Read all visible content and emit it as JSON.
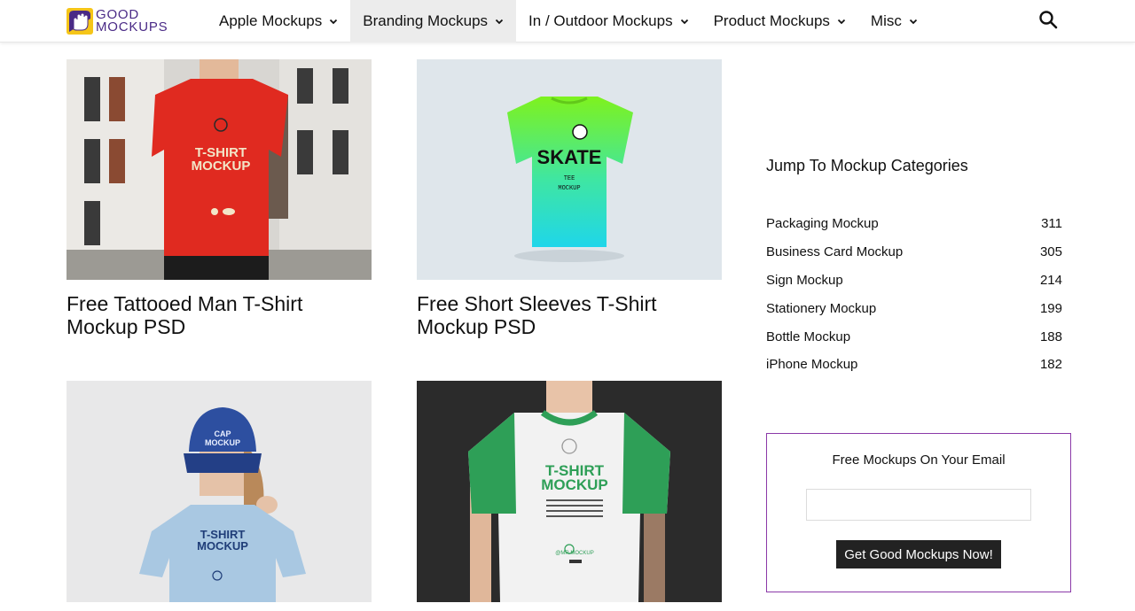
{
  "brand": {
    "logo_line1": "GOOD",
    "logo_line2": "MOCKUPS",
    "accent_color": "#4a2a86",
    "accent_yellow": "#f5c518"
  },
  "nav": {
    "items": [
      {
        "label": "Apple Mockups",
        "active": false
      },
      {
        "label": "Branding Mockups",
        "active": true
      },
      {
        "label": "In / Outdoor Mockups",
        "active": false
      },
      {
        "label": "Product Mockups",
        "active": false
      },
      {
        "label": "Misc",
        "active": false
      }
    ],
    "search_icon": "search-icon"
  },
  "posts": [
    {
      "title": "Free Tattooed Man T-Shirt Mockup PSD",
      "image_text": {
        "line1": "T-SHIRT",
        "line2": "MOCKUP"
      }
    },
    {
      "title": "Free Short Sleeves T-Shirt Mockup PSD",
      "image_text": {
        "line1": "SKATE",
        "line2": "TEE",
        "line3": "MOCKUP"
      }
    },
    {
      "title": "",
      "image_text": {
        "cap1": "CAP",
        "cap2": "MOCKUP",
        "line1": "T-SHIRT",
        "line2": "MOCKUP"
      }
    },
    {
      "title": "",
      "image_text": {
        "line1": "T-SHIRT",
        "line2": "MOCKUP",
        "handle": "@MR.MOCKUP"
      }
    }
  ],
  "sidebar": {
    "title": "Jump To Mockup Categories",
    "categories": [
      {
        "name": "Packaging Mockup",
        "count": "311"
      },
      {
        "name": "Business Card Mockup",
        "count": "305"
      },
      {
        "name": "Sign Mockup",
        "count": "214"
      },
      {
        "name": "Stationery Mockup",
        "count": "199"
      },
      {
        "name": "Bottle Mockup",
        "count": "188"
      },
      {
        "name": "iPhone Mockup",
        "count": "182"
      }
    ],
    "newsletter": {
      "title": "Free Mockups On Your Email",
      "placeholder": "",
      "value": "",
      "button_label": "Get Good Mockups Now!",
      "border_color": "#8b3aa8"
    }
  }
}
